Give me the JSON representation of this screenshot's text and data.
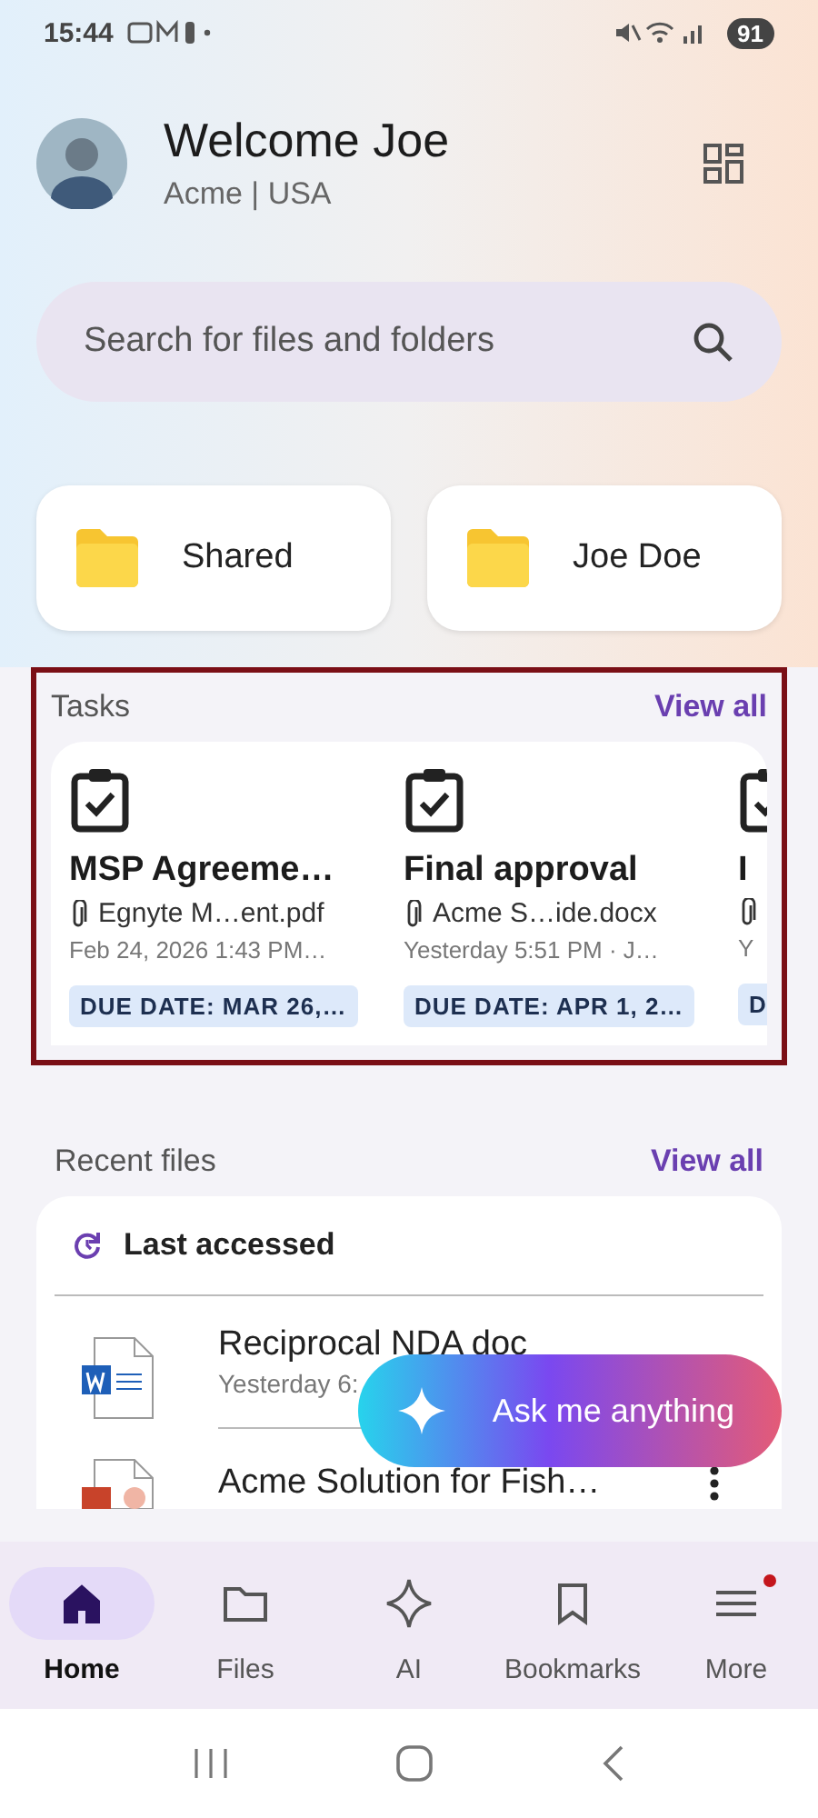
{
  "status_bar": {
    "time": "15:44",
    "battery": "91"
  },
  "header": {
    "title": "Welcome Joe",
    "subtitle": "Acme | USA"
  },
  "search": {
    "placeholder": "Search for files and folders"
  },
  "folders": [
    {
      "label": "Shared"
    },
    {
      "label": "Joe Doe"
    }
  ],
  "tasks": {
    "title": "Tasks",
    "view_all": "View all",
    "items": [
      {
        "title": "MSP Agreeme…",
        "file": "Egnyte M…ent.pdf",
        "meta": "Feb 24, 2026 1:43 PM…",
        "due": "DUE DATE: MAR 26,…"
      },
      {
        "title": "Final approval",
        "file": "Acme S…ide.docx",
        "meta": "Yesterday 5:51 PM · J…",
        "due": "DUE DATE: APR 1, 2…"
      },
      {
        "title": "I",
        "meta": "Y",
        "due": "D"
      }
    ]
  },
  "recent_files": {
    "title": "Recent files",
    "view_all": "View all",
    "filter": "Last accessed",
    "items": [
      {
        "kind": "word",
        "name": "Reciprocal NDA doc",
        "meta": "Yesterday 6:"
      },
      {
        "kind": "powerpoint",
        "name": "Acme Solution for Fish…",
        "menu": true
      }
    ]
  },
  "assistant_button": {
    "label": "Ask me anything"
  },
  "nav": [
    {
      "label": "Home",
      "selected": true,
      "badge": false
    },
    {
      "label": "Files",
      "selected": false,
      "badge": false
    },
    {
      "label": "AI",
      "selected": false,
      "badge": false
    },
    {
      "label": "Bookmarks",
      "selected": false,
      "badge": false
    },
    {
      "label": "More",
      "selected": false,
      "badge": true
    }
  ]
}
